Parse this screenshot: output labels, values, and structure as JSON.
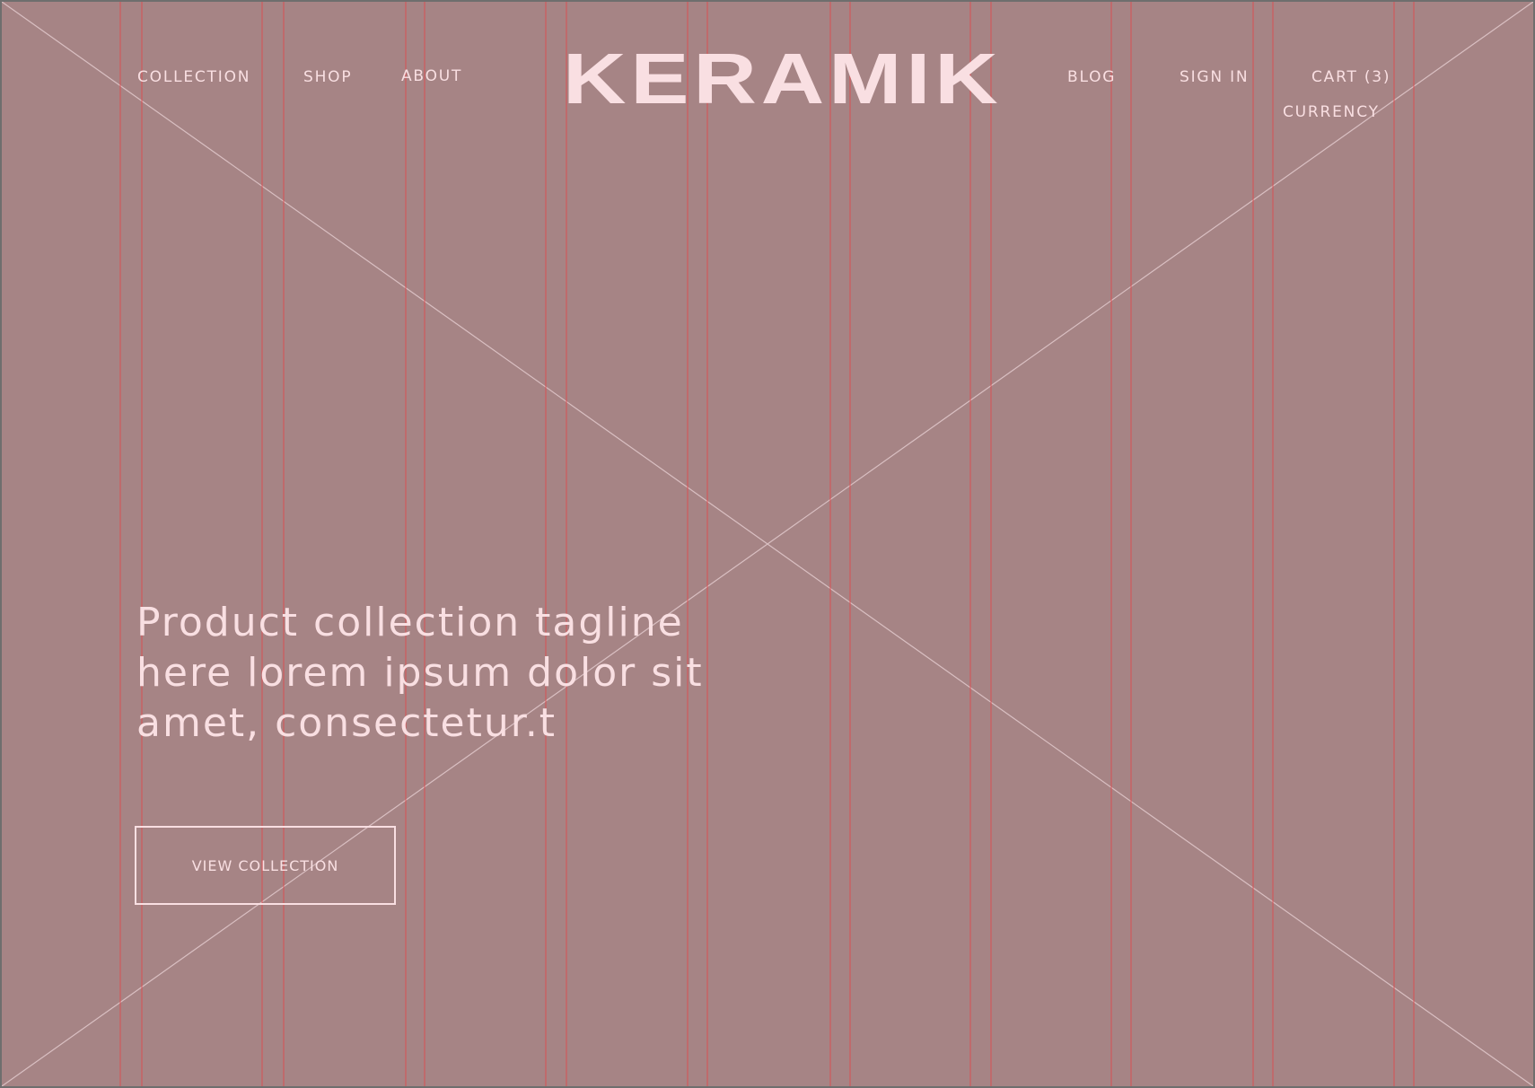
{
  "brand": {
    "logo_text": "KERAMIK"
  },
  "nav_left": [
    {
      "label": "COLLECTION"
    },
    {
      "label": "SHOP"
    },
    {
      "label": "ABOUT"
    }
  ],
  "nav_right": {
    "blog": "BLOG",
    "sign_in": "SIGN IN",
    "cart": "CART (3)",
    "currency": "CURRENCY"
  },
  "hero": {
    "tagline_lines": [
      "Product collection tagline",
      "here lorem ipsum dolor sit",
      "amet, consectetur.t"
    ],
    "cta_label": "VIEW COLLECTION"
  },
  "colors": {
    "background": "#a68485",
    "frame": "#6e6e6e",
    "text": "#f9dfe2",
    "grid_line": "#e0464b",
    "placeholder_cross": "#d9bfc2"
  },
  "icons": {
    "image_placeholder": "placeholder-cross-icon"
  }
}
